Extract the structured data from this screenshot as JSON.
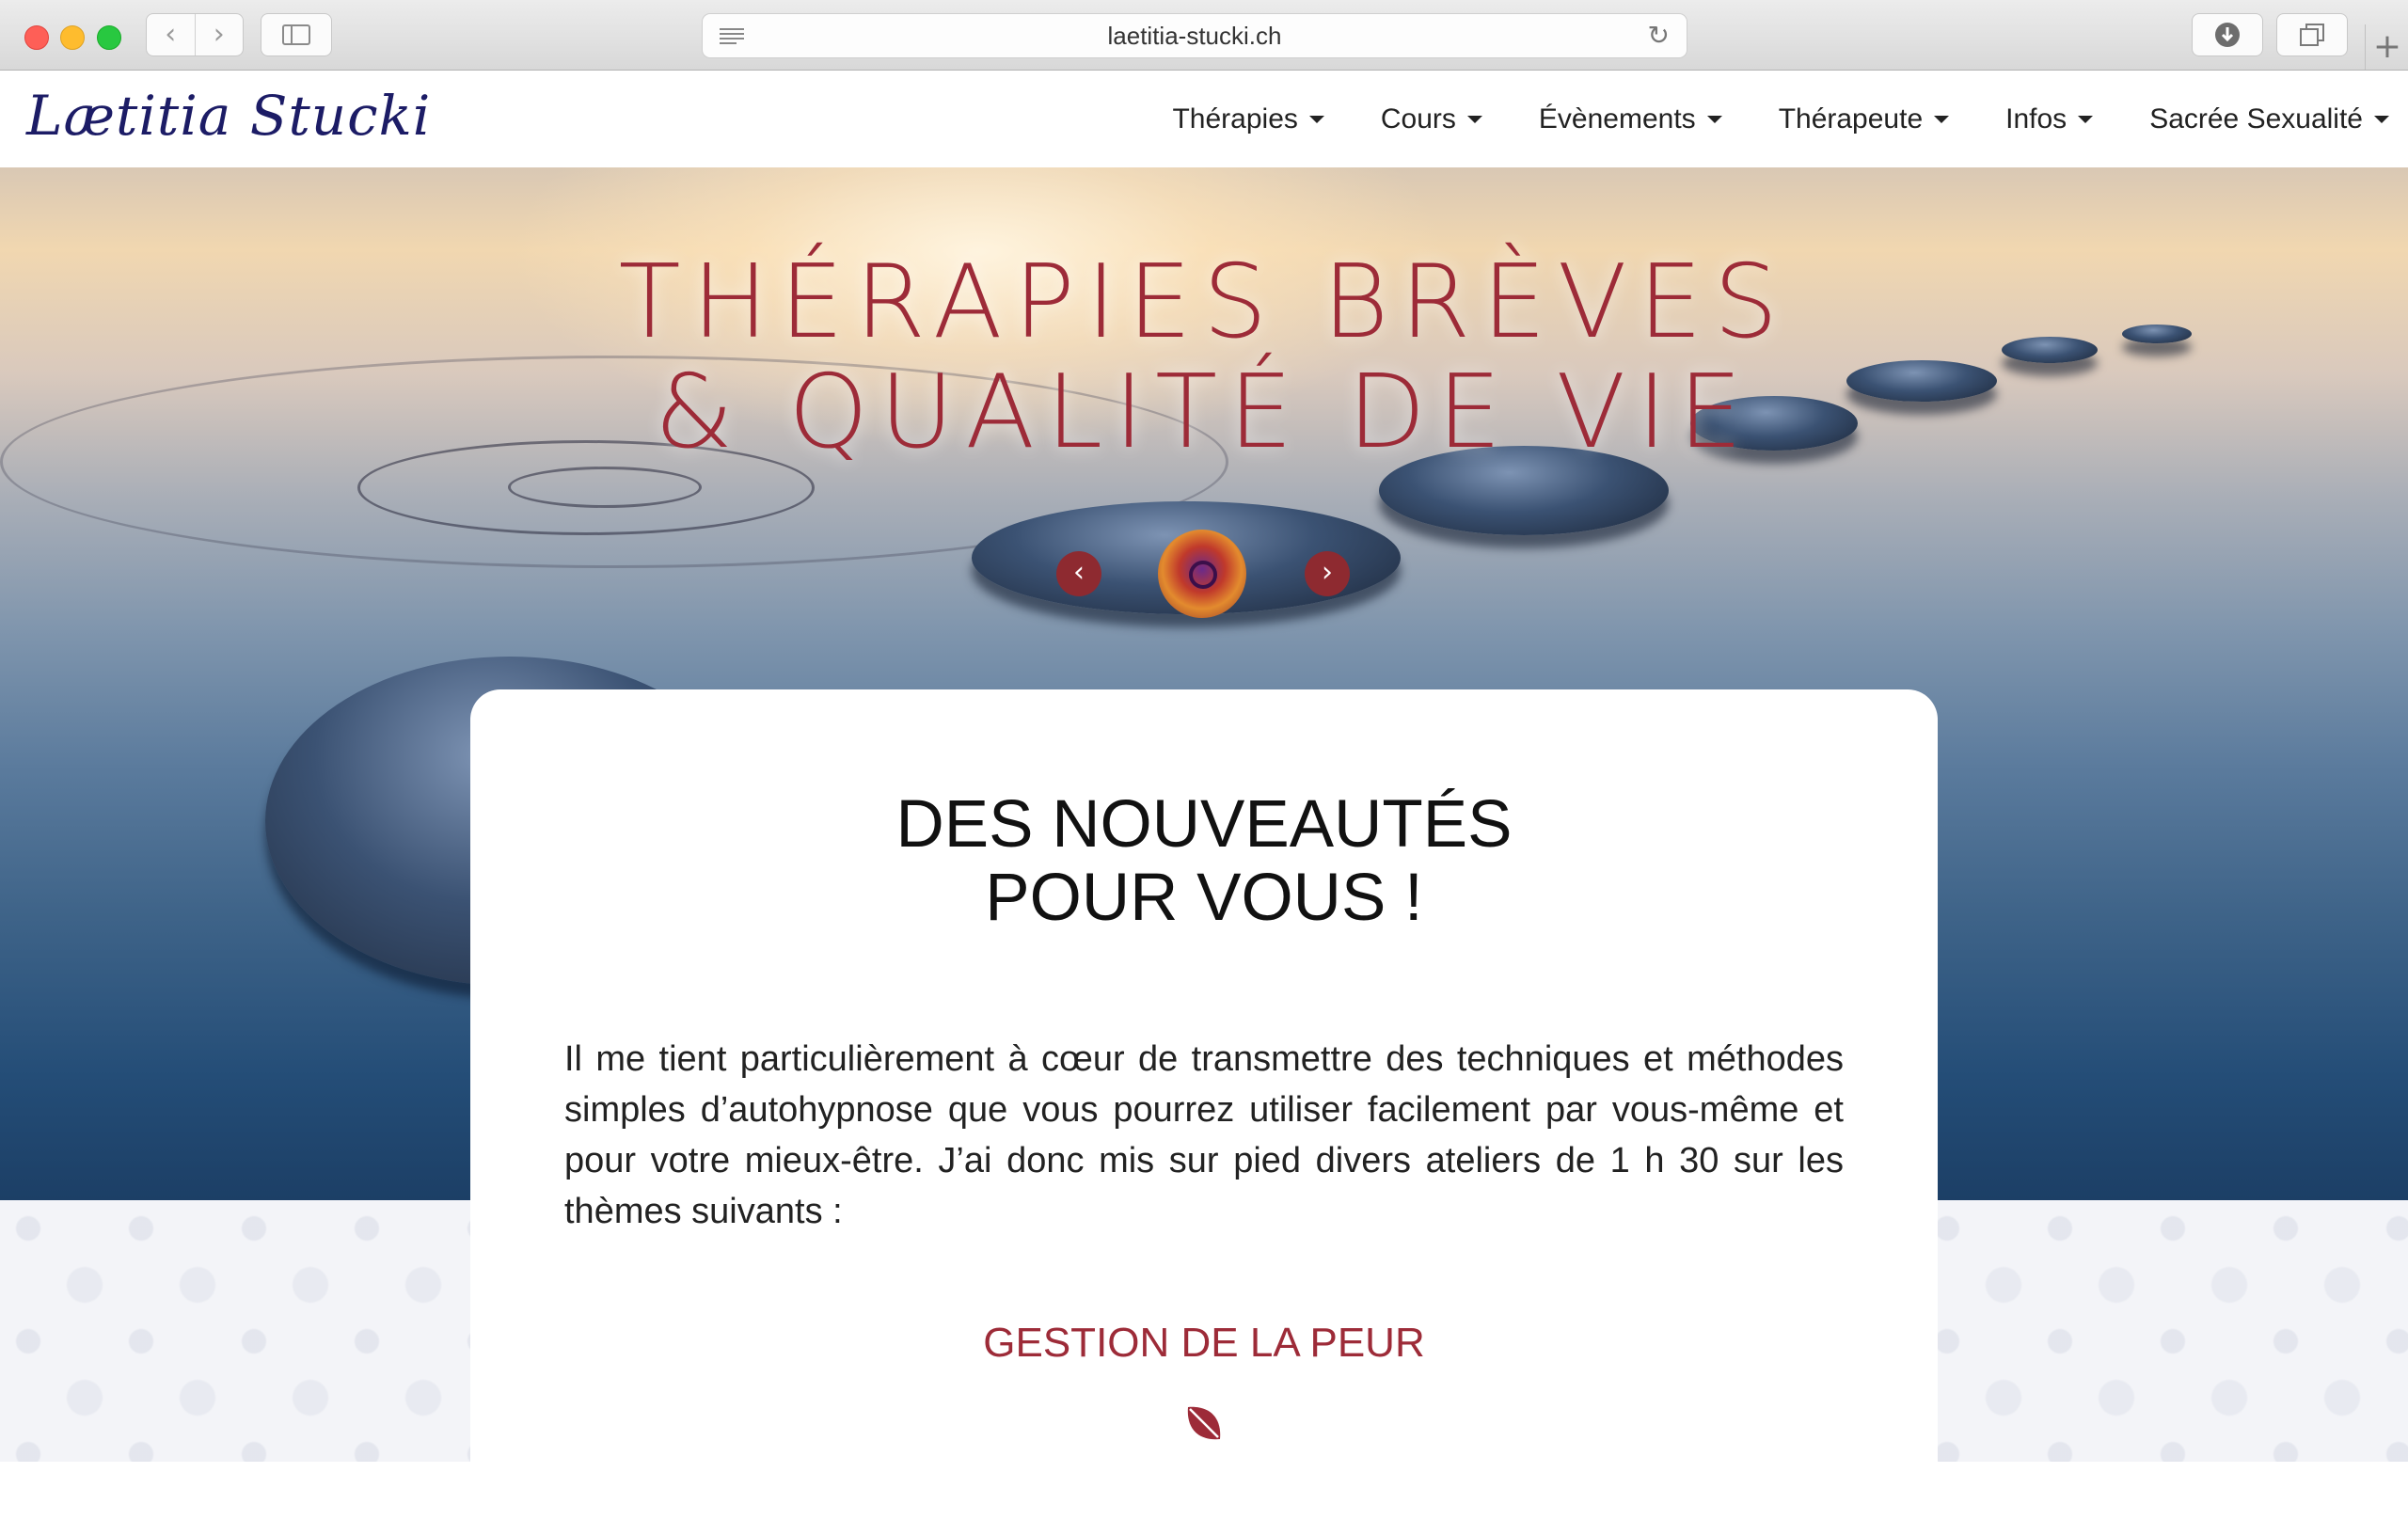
{
  "browser": {
    "url": "laetitia-stucki.ch",
    "back_icon": "chevron-left",
    "forward_icon": "chevron-right",
    "reload_icon": "reload",
    "new_tab_icon": "plus"
  },
  "site": {
    "logo": "Lætitia Stucki",
    "menu": [
      {
        "label": "Thérapies"
      },
      {
        "label": "Cours"
      },
      {
        "label": "Évènements"
      },
      {
        "label": "Thérapeute"
      },
      {
        "label": "Infos"
      },
      {
        "label": "Sacrée Sexualité"
      }
    ]
  },
  "hero": {
    "title_line1": "THÉRAPIES BRÈVES",
    "title_line2": "& QUALITÉ DE VIE",
    "prev_icon": "‹",
    "next_icon": "›"
  },
  "card": {
    "title_line1": "DES NOUVEAUTÉS",
    "title_line2": "POUR VOUS !",
    "text": "Il me tient particulièrement à cœur de transmettre des techniques et méthodes simples d’autohypnose que vous pourrez utiliser facilement par vous-même et pour votre mieux-être. J’ai donc mis sur pied divers ateliers de 1 h 30 sur les thèmes suivants :",
    "subtitle": "GESTION DE LA PEUR"
  },
  "colors": {
    "accent": "#9d2b38",
    "logo": "#1c1c66"
  }
}
